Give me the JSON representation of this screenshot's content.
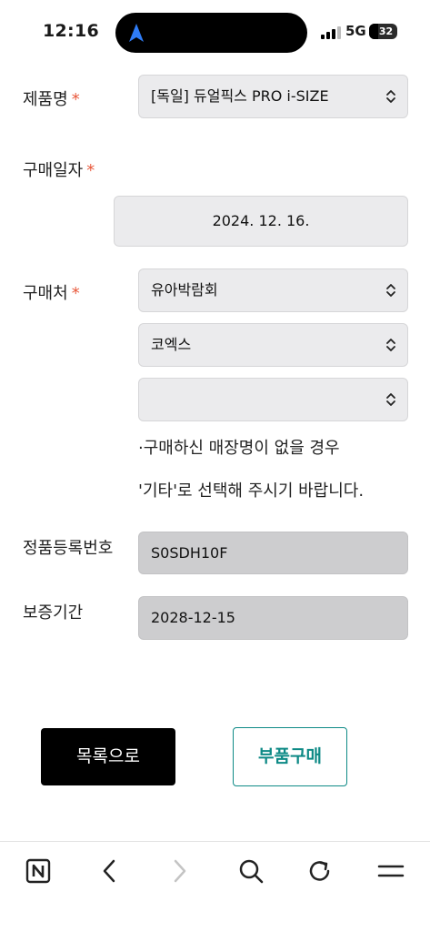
{
  "status_bar": {
    "time": "12:16",
    "network": "5G",
    "battery": "32"
  },
  "form": {
    "product": {
      "label": "제품명",
      "required_mark": "*",
      "value": "[독일] 듀얼픽스 PRO i-SIZE"
    },
    "purchase_date": {
      "label": "구매일자",
      "required_mark": "*",
      "value": "2024. 12. 16."
    },
    "purchase_place": {
      "label": "구매처",
      "required_mark": "*",
      "select1_value": "유아박람회",
      "select2_value": "코엑스",
      "select3_value": ""
    },
    "note_line1": "·구매하신 매장명이 없을 경우",
    "note_line2": "'기타'로 선택해 주시기 바랍니다.",
    "registration_number": {
      "label": "정품등록번호",
      "value": "S0SDH10F"
    },
    "warranty_period": {
      "label": "보증기간",
      "value": "2028-12-15"
    }
  },
  "buttons": {
    "list_label": "목록으로",
    "parts_label": "부품구매"
  },
  "browser_toolbar": {
    "icons": [
      "naver-icon",
      "back-icon",
      "forward-icon",
      "search-icon",
      "refresh-icon",
      "menu-icon"
    ]
  },
  "colors": {
    "required": "#e8593c",
    "accent": "#0e8a86",
    "field_bg": "#ebebed",
    "readonly_bg": "#cdcdcf"
  }
}
